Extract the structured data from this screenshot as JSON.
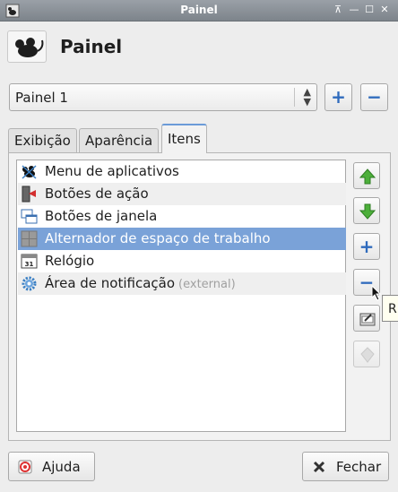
{
  "window": {
    "title": "Painel"
  },
  "header": {
    "title": "Painel",
    "icon": "xfce-mouse-icon"
  },
  "panel_selector": {
    "value": "Painel 1"
  },
  "tabs": [
    {
      "label": "Exibição"
    },
    {
      "label": "Aparência"
    },
    {
      "label": "Itens"
    }
  ],
  "active_tab": "Itens",
  "items": [
    {
      "label": "Menu de aplicativos",
      "suffix": "",
      "icon": "applications-menu-icon"
    },
    {
      "label": "Botões de ação",
      "suffix": "",
      "icon": "action-buttons-icon"
    },
    {
      "label": "Botões de janela",
      "suffix": "",
      "icon": "window-buttons-icon"
    },
    {
      "label": "Alternador de espaço de trabalho",
      "suffix": "",
      "icon": "workspace-switcher-icon"
    },
    {
      "label": "Relógio",
      "suffix": "",
      "icon": "clock-icon"
    },
    {
      "label": "Área de notificação",
      "suffix": "(external)",
      "icon": "gear-icon"
    }
  ],
  "selected_item": "Alternador de espaço de trabalho",
  "tooltip": {
    "text": "R"
  },
  "buttons": {
    "help": "Ajuda",
    "close": "Fechar"
  },
  "clock_icon_text": "31"
}
